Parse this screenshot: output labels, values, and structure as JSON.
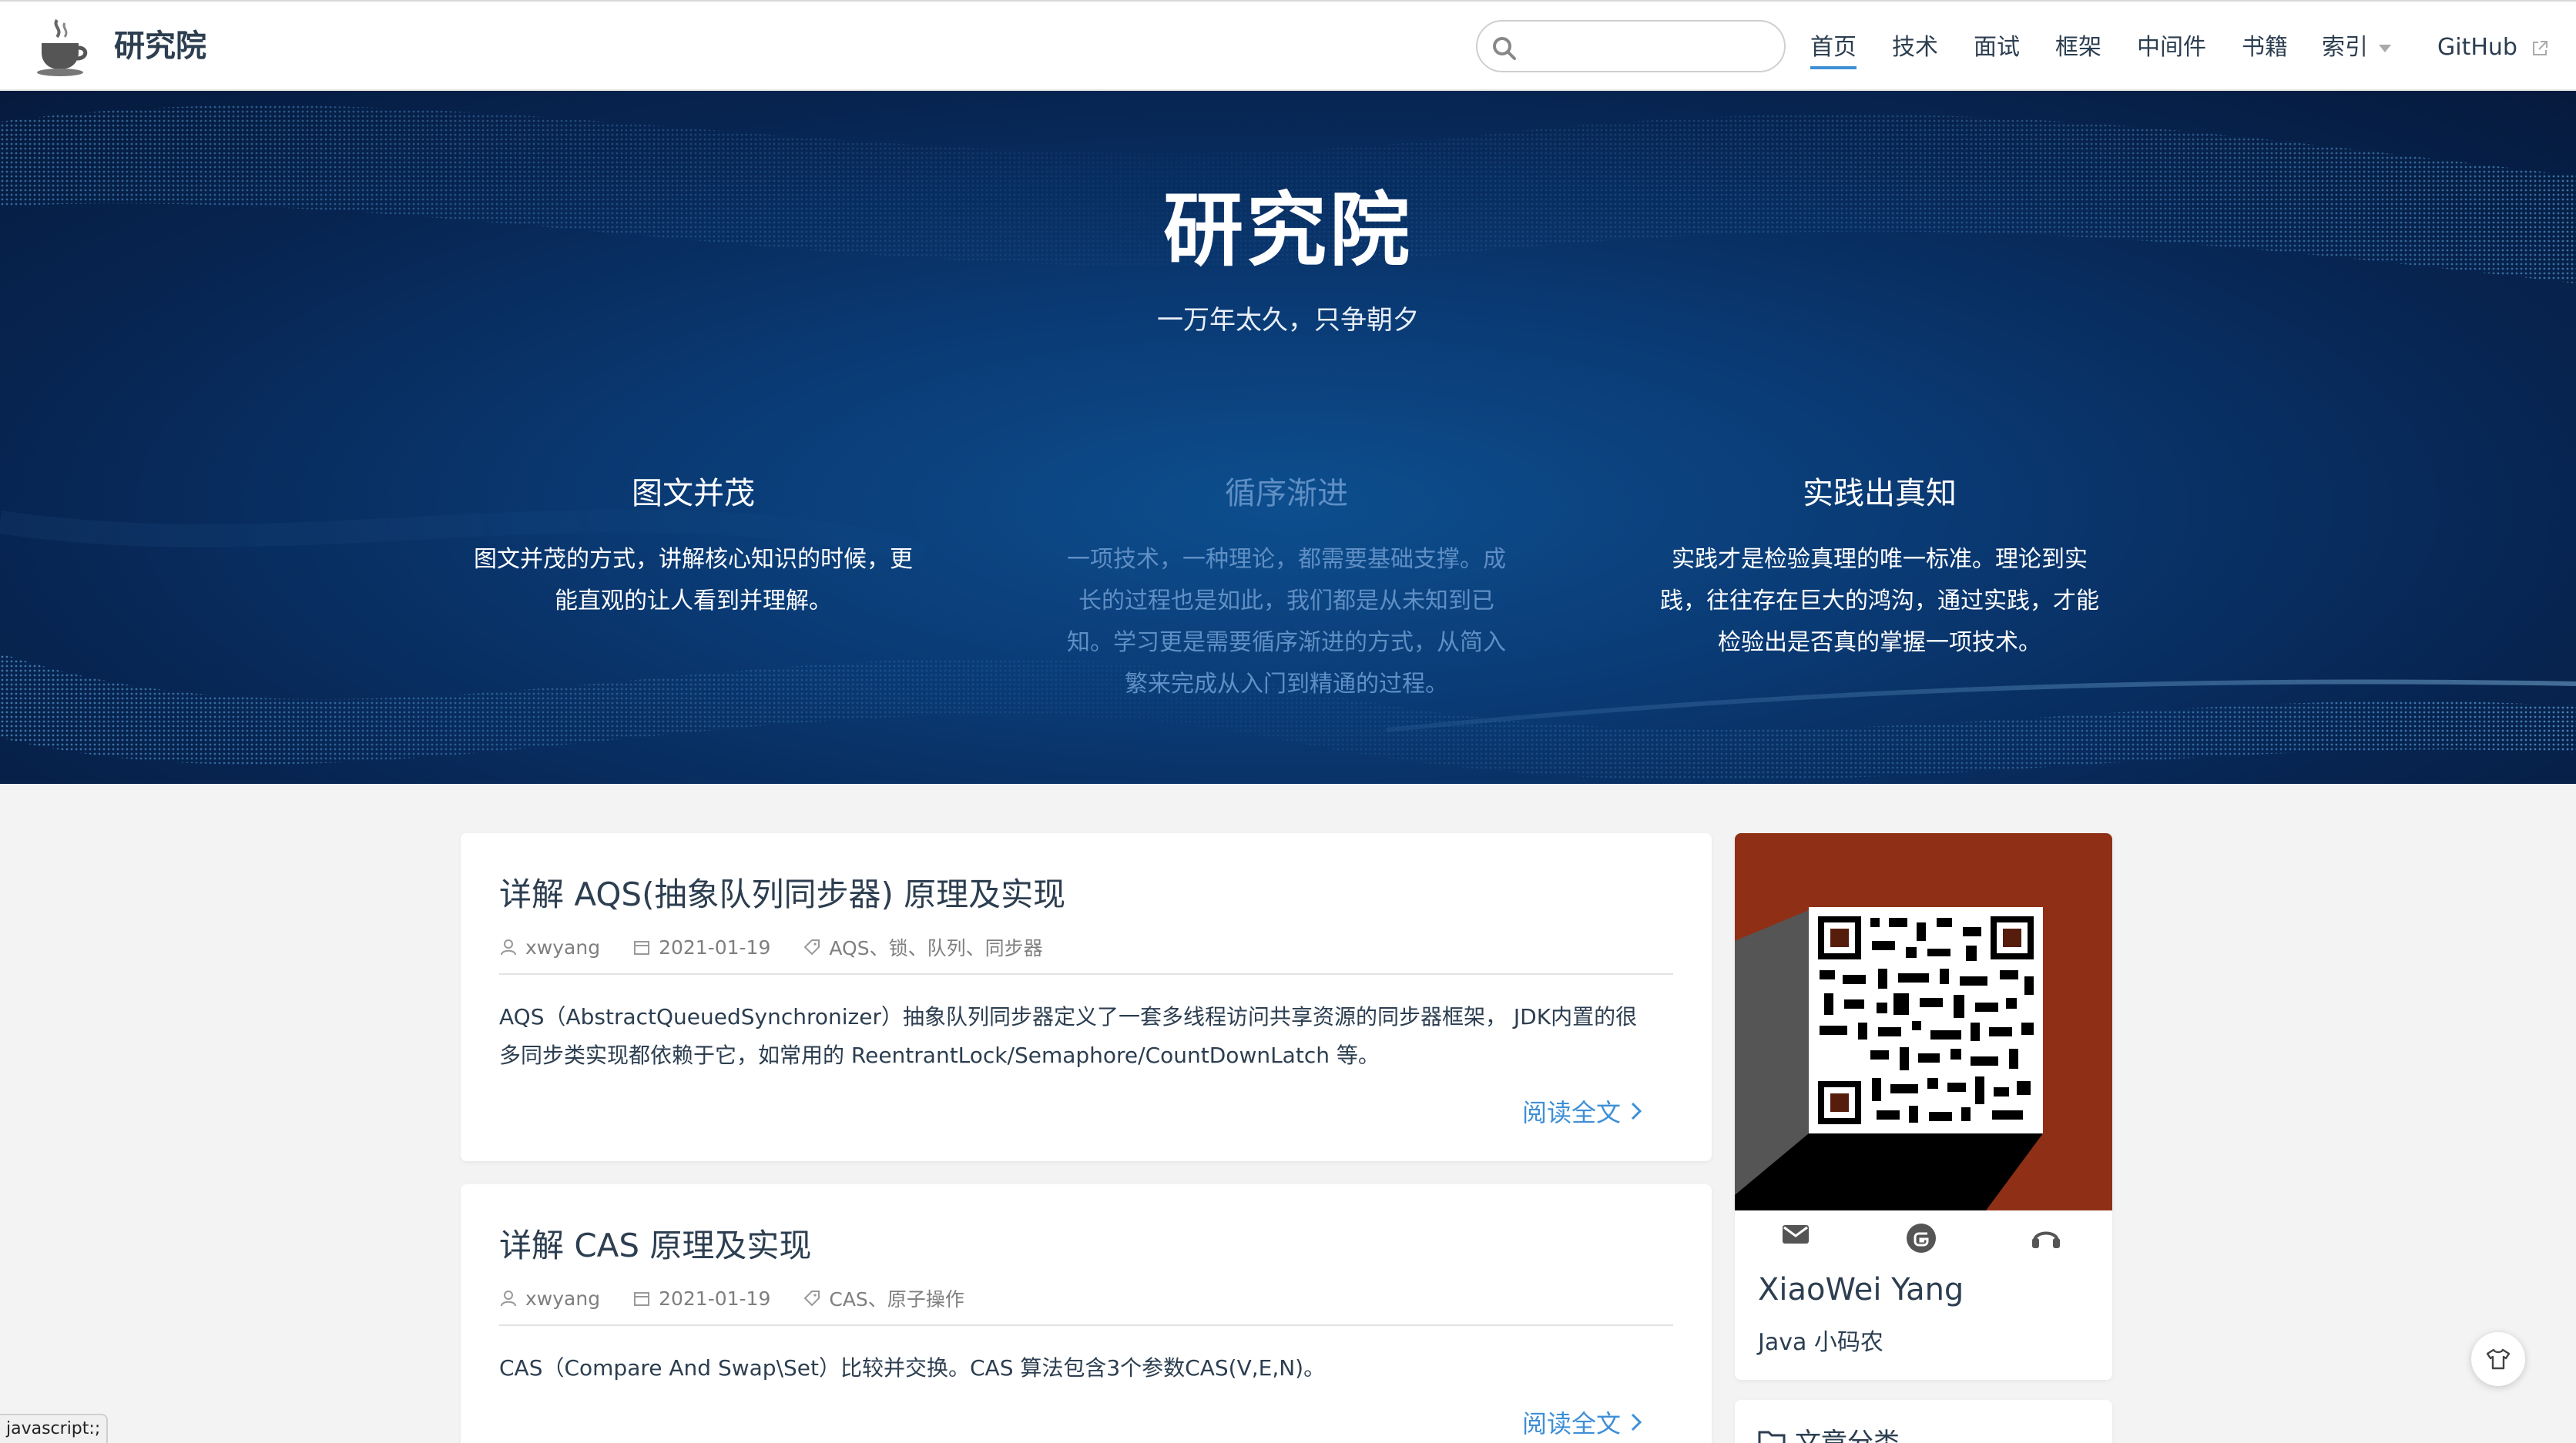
{
  "site": {
    "name": "研究院"
  },
  "search": {
    "placeholder": "",
    "value": ""
  },
  "nav": {
    "items": [
      {
        "label": "首页",
        "active": true
      },
      {
        "label": "技术"
      },
      {
        "label": "面试"
      },
      {
        "label": "框架"
      },
      {
        "label": "中间件"
      },
      {
        "label": "书籍"
      },
      {
        "label": "索引",
        "has_dropdown": true
      },
      {
        "label": "GitHub",
        "external": true
      }
    ]
  },
  "hero": {
    "title": "研究院",
    "subtitle": "一万年太久，只争朝夕",
    "features": [
      {
        "title": "图文并茂",
        "lines": [
          "图文并茂的方式，讲解核心知识的时候，更",
          "能直观的让人看到并理解。"
        ]
      },
      {
        "title": "循序渐进",
        "lines": [
          "一项技术，一种理论，都需要基础支撑。成",
          "长的过程也是如此，我们都是从未知到已",
          "知。学习更是需要循序渐进的方式，从简入",
          "繁来完成从入门到精通的过程。"
        ]
      },
      {
        "title": "实践出真知",
        "lines": [
          "实践才是检验真理的唯一标准。理论到实",
          "践，往往存在巨大的鸿沟，通过实践，才能",
          "检验出是否真的掌握一项技术。"
        ]
      }
    ]
  },
  "posts": [
    {
      "title": "详解 AQS(抽象队列同步器) 原理及实现",
      "author": "xwyang",
      "date": "2021-01-19",
      "tags": "AQS、锁、队列、同步器",
      "excerpt_lines": [
        "AQS（AbstractQueuedSynchronizer）抽象队列同步器定义了一套多线程访问共享资源的同步器框架， JDK内置的很",
        "多同步类实现都依赖于它，如常用的 ReentrantLock/Semaphore/CountDownLatch 等。"
      ],
      "read_more": "阅读全文"
    },
    {
      "title": "详解 CAS 原理及实现",
      "author": "xwyang",
      "date": "2021-01-19",
      "tags": "CAS、原子操作",
      "excerpt_lines": [
        "CAS（Compare And Swap\\Set）比较并交换。CAS 算法包含3个参数CAS(V,E,N)。"
      ],
      "read_more": "阅读全文"
    }
  ],
  "profile": {
    "name": "XiaoWei Yang",
    "description": "Java 小码农",
    "social_icons": [
      "mail-icon",
      "gitee-icon",
      "headphones-icon"
    ],
    "banner_color": "#8f3016"
  },
  "category": {
    "title": "文章分类"
  },
  "status_bar": {
    "text": "javascript:;"
  },
  "colors": {
    "accent": "#3e8fd6",
    "hero_dim_text": "#5f8fc4"
  }
}
